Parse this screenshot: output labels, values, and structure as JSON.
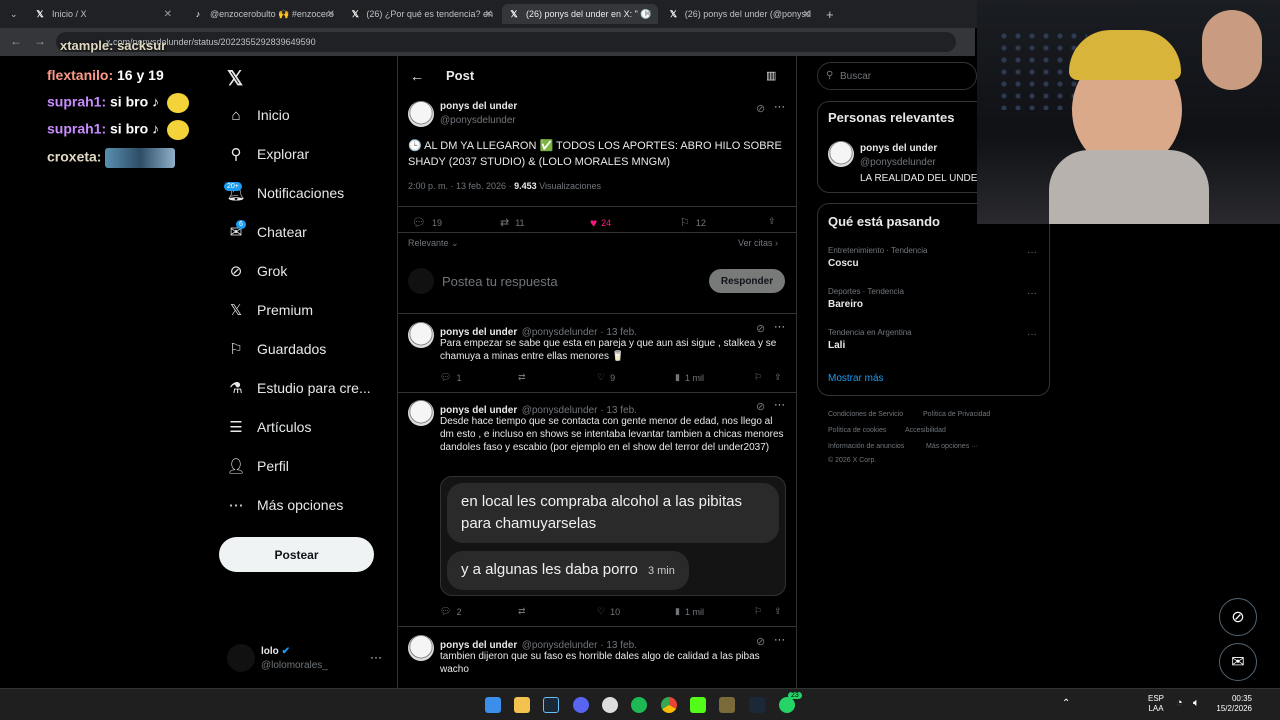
{
  "browser": {
    "tabs": [
      {
        "icon": "x-logo-icon",
        "label": "Inicio / X"
      },
      {
        "icon": "tiktok-icon",
        "label": "@enzocerobulto 🙌 #enzocero"
      },
      {
        "icon": "x-logo-icon",
        "label": "(26) ¿Por qué es tendencia? en"
      },
      {
        "icon": "x-logo-icon",
        "label": "(26) ponys del under en X: \" 🕒"
      },
      {
        "icon": "x-logo-icon",
        "label": "(26) ponys del under (@ponysd"
      }
    ],
    "url": "x.com/ponysdelunder/status/2022355292839649590"
  },
  "overlay_chat": [
    {
      "user": "flextanilo:",
      "msg": "16 y 19"
    },
    {
      "user": "suprah1:",
      "msg": "si bro ♪"
    },
    {
      "user": "suprah1:",
      "msg": "si bro ♪"
    },
    {
      "user": "croxeta:",
      "msg": ""
    }
  ],
  "overlay_top": "xtample: sacksur",
  "nav": {
    "items": [
      {
        "icon": "home-icon",
        "label": "Inicio"
      },
      {
        "icon": "search-icon",
        "label": "Explorar"
      },
      {
        "icon": "bell-icon",
        "label": "Notificaciones",
        "badge": "20+"
      },
      {
        "icon": "mail-icon",
        "label": "Chatear",
        "badge": "6"
      },
      {
        "icon": "grok-icon",
        "label": "Grok"
      },
      {
        "icon": "x-logo-icon",
        "label": "Premium"
      },
      {
        "icon": "bookmark-icon",
        "label": "Guardados"
      },
      {
        "icon": "flask-icon",
        "label": "Estudio para cre..."
      },
      {
        "icon": "article-icon",
        "label": "Artículos"
      },
      {
        "icon": "person-icon",
        "label": "Perfil"
      },
      {
        "icon": "more-circle-icon",
        "label": "Más opciones"
      }
    ],
    "post_button": "Postear",
    "account": {
      "name": "lolo",
      "handle": "@lolomorales_"
    }
  },
  "header": {
    "title": "Post"
  },
  "main_post": {
    "name": "ponys del under",
    "handle": "@ponysdelunder",
    "text": "🕒 AL DM YA LLEGARON ✅ TODOS LOS APORTES: ABRO HILO SOBRE SHADY (2037 STUDIO) & (LOLO MORALES MNGM)",
    "time": "2:00 p. m. · 13 feb. 2026 ·",
    "views": "9.453",
    "views_label": "Visualizaciones",
    "replies": "19",
    "reposts": "11",
    "likes": "24",
    "bookmarks": "12",
    "sort": "Relevante",
    "quotes": "Ver citas"
  },
  "reply_box": {
    "placeholder": "Postea tu respuesta",
    "button": "Responder"
  },
  "replies": [
    {
      "name": "ponys del under",
      "handle": "@ponysdelunder · 13 feb.",
      "text": "Para empezar se sabe que esta en pareja y que aun asi sigue , stalkea y se chamuya a minas entre ellas menores 🥛",
      "replies": "1",
      "reposts": "",
      "likes": "9",
      "views": "1 mil"
    },
    {
      "name": "ponys del under",
      "handle": "@ponysdelunder · 13 feb.",
      "text": "Desde hace tiempo que se contacta con gente menor de edad, nos llego al dm esto , e incluso en shows se intentaba levantar tambien a chicas menores dandoles faso y escabio (por ejemplo en el show del terror del under2037)",
      "bubble1": "en local les compraba alcohol a las pibitas para chamuyarselas",
      "bubble2": "y a algunas les daba porro",
      "bubble_time": "3 min",
      "replies": "2",
      "reposts": "",
      "likes": "10",
      "views": "1 mil"
    },
    {
      "name": "ponys del under",
      "handle": "@ponysdelunder · 13 feb.",
      "text": "tambien dijeron que su faso es horrible dales algo de calidad a las pibas wacho"
    }
  ],
  "right": {
    "search_placeholder": "Buscar",
    "relevant_title": "Personas relevantes",
    "relevant_person": {
      "name": "ponys del under",
      "handle": "@ponysdelunder",
      "bio": "LA REALIDAD DEL UNDER"
    },
    "trends_title": "Qué está pasando",
    "trends": [
      {
        "category": "Entretenimiento · Tendencia",
        "name": "Coscu"
      },
      {
        "category": "Deportes · Tendencia",
        "name": "Bareiro"
      },
      {
        "category": "Tendencia en Argentina",
        "name": "Lali"
      }
    ],
    "show_more": "Mostrar más",
    "footer": [
      "Condiciones de Servicio",
      "Política de Privacidad",
      "Política de cookies",
      "Accesibilidad",
      "Información de anuncios",
      "Más opciones ···",
      "© 2026 X Corp."
    ]
  },
  "taskbar": {
    "lang1": "ESP",
    "lang2": "LAA",
    "time": "00:35",
    "date": "15/2/2026",
    "whatsapp_badge": "23"
  },
  "colors": {
    "accent": "#1d9bf0",
    "like": "#f91880",
    "bg": "#000000",
    "border": "#2f3336"
  }
}
